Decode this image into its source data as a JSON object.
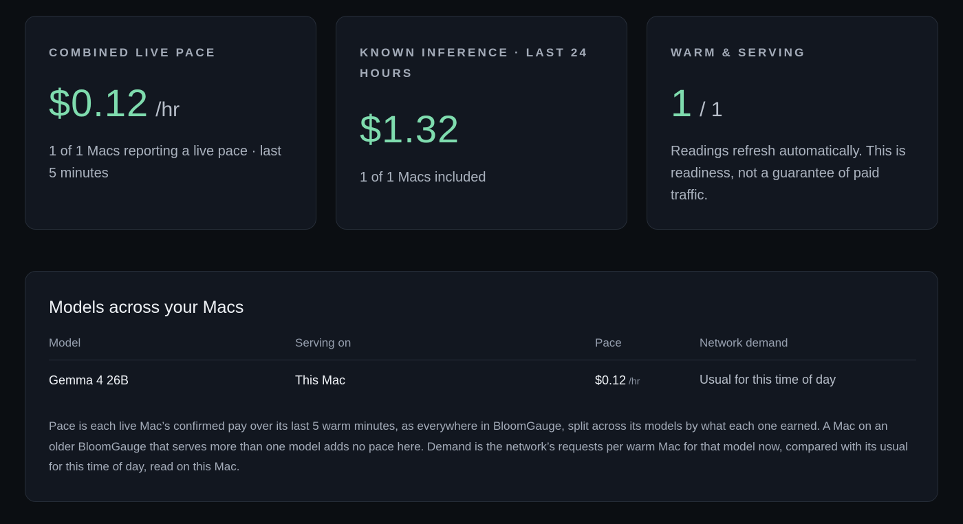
{
  "stats": [
    {
      "label": "COMBINED LIVE PACE",
      "value": "$0.12",
      "unit": "/hr",
      "note": "1 of 1 Macs reporting a live pace · last 5 minutes"
    },
    {
      "label": "KNOWN INFERENCE · LAST 24 HOURS",
      "value": "$1.32",
      "unit": "",
      "note": "1 of 1 Macs included"
    },
    {
      "label": "WARM & SERVING",
      "value": "1",
      "unit": "/ 1",
      "note": "Readings refresh automatically. This is readiness, not a guarantee of paid traffic."
    }
  ],
  "models": {
    "title": "Models across your Macs",
    "columns": {
      "model": "Model",
      "serving_on": "Serving on",
      "pace": "Pace",
      "network_demand": "Network demand"
    },
    "rows": [
      {
        "model": "Gemma 4 26B",
        "serving_on": "This Mac",
        "pace": "$0.12",
        "pace_unit": "/hr",
        "network_demand": "Usual for this time of day"
      }
    ],
    "footnote": "Pace is each live Mac’s confirmed pay over its last 5 warm minutes, as everywhere in BloomGauge, split across its models by what each one earned. A Mac on an older BloomGauge that serves more than one model adds no pace here. Demand is the network’s requests per warm Mac for that model now, compared with its usual for this time of day, read on this Mac."
  },
  "colors": {
    "background": "#0b0e12",
    "card": "#121720",
    "accent_green": "#7fdcae"
  }
}
